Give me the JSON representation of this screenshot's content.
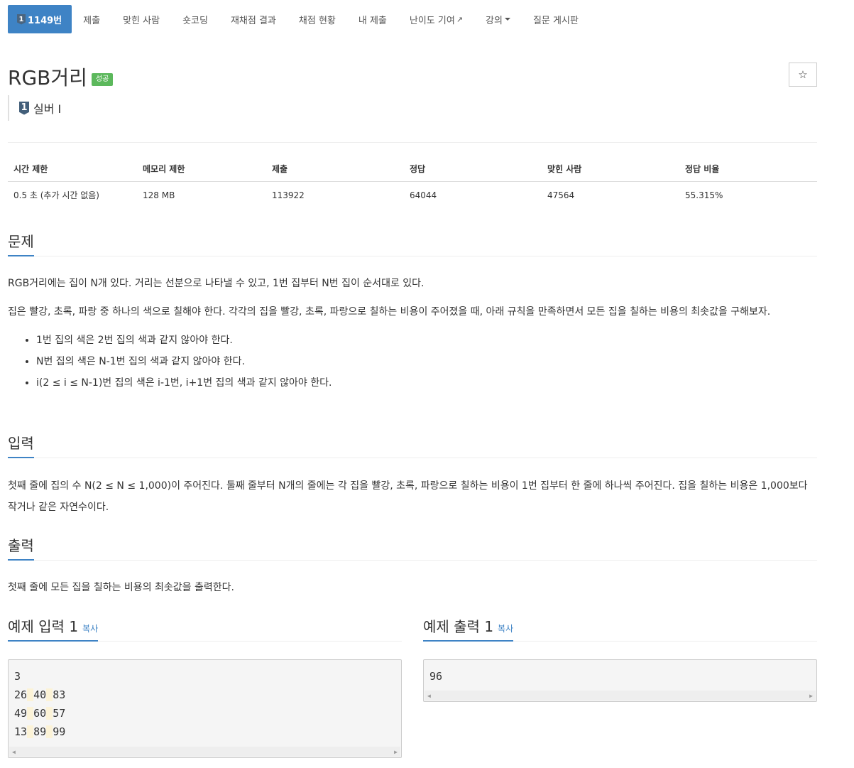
{
  "nav": {
    "problem_tab": {
      "tier": "1",
      "label": "1149번"
    },
    "items": [
      "제출",
      "맞힌 사람",
      "숏코딩",
      "재채점 결과",
      "채점 현황",
      "내 제출",
      "난이도 기여",
      "강의",
      "질문 게시판"
    ]
  },
  "problem": {
    "title": "RGB거리",
    "status_label": "성공",
    "star": "☆",
    "tier_num": "1",
    "tier_name": "실버 I"
  },
  "info_table": {
    "headers": [
      "시간 제한",
      "메모리 제한",
      "제출",
      "정답",
      "맞힌 사람",
      "정답 비율"
    ],
    "values": [
      "0.5 초 (추가 시간 없음)",
      "128 MB",
      "113922",
      "64044",
      "47564",
      "55.315%"
    ]
  },
  "sections": {
    "problem_head": "문제",
    "problem_p1": "RGB거리에는 집이 N개 있다. 거리는 선분으로 나타낼 수 있고, 1번 집부터 N번 집이 순서대로 있다.",
    "problem_p2": "집은 빨강, 초록, 파랑 중 하나의 색으로 칠해야 한다. 각각의 집을 빨강, 초록, 파랑으로 칠하는 비용이 주어졌을 때, 아래 규칙을 만족하면서 모든 집을 칠하는 비용의 최솟값을 구해보자.",
    "rules": [
      "1번 집의 색은 2번 집의 색과 같지 않아야 한다.",
      "N번 집의 색은 N-1번 집의 색과 같지 않아야 한다.",
      "i(2 ≤ i ≤ N-1)번 집의 색은 i-1번, i+1번 집의 색과 같지 않아야 한다."
    ],
    "input_head": "입력",
    "input_text": "첫째 줄에 집의 수 N(2 ≤ N ≤ 1,000)이 주어진다. 둘째 줄부터 N개의 줄에는 각 집을 빨강, 초록, 파랑으로 칠하는 비용이 1번 집부터 한 줄에 하나씩 주어진다. 집을 칠하는 비용은 1,000보다 작거나 같은 자연수이다.",
    "output_head": "출력",
    "output_text": "첫째 줄에 모든 집을 칠하는 비용의 최솟값을 출력한다."
  },
  "samples": {
    "input_head": "예제 입력 1",
    "output_head": "예제 출력 1",
    "copy_label": "복사",
    "input_lines": [
      [
        "3"
      ],
      [
        "26",
        "40",
        "83"
      ],
      [
        "49",
        "60",
        "57"
      ],
      [
        "13",
        "89",
        "99"
      ]
    ],
    "output_lines": [
      "96"
    ]
  }
}
